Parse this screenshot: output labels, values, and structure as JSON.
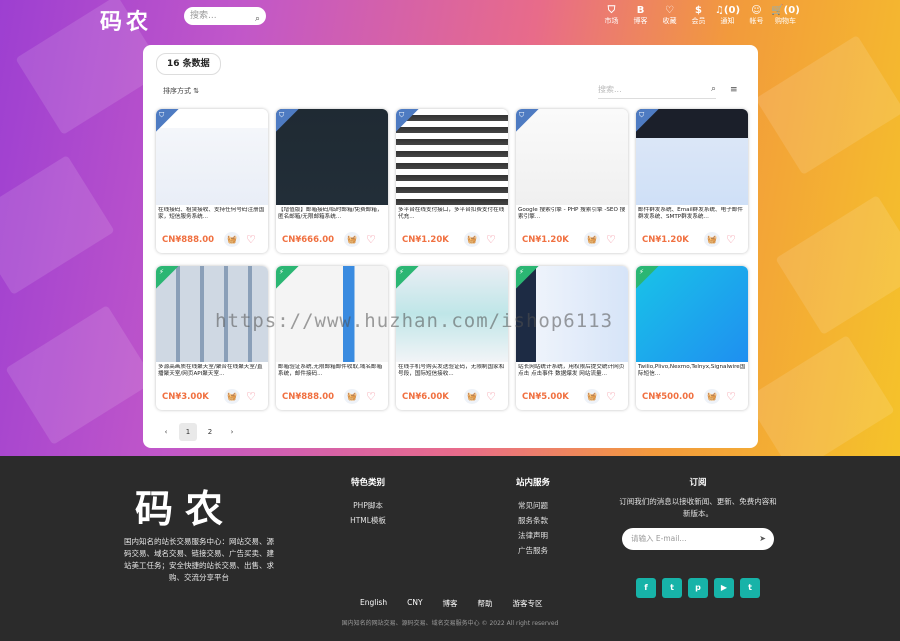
{
  "header": {
    "logo": "码农",
    "search_placeholder": "搜索...",
    "nav": [
      {
        "icon": "tag-icon",
        "glyph": "⛉",
        "label": "市场"
      },
      {
        "icon": "bitcoin-icon",
        "glyph": "B",
        "label": "博客"
      },
      {
        "icon": "heart-icon",
        "glyph": "♡",
        "label": "收藏"
      },
      {
        "icon": "dollar-icon",
        "glyph": "$",
        "label": "会员"
      },
      {
        "icon": "bell-icon",
        "glyph": "♫(0)",
        "label": "通知"
      },
      {
        "icon": "user-icon",
        "glyph": "☺",
        "label": "帐号"
      },
      {
        "icon": "cart-icon",
        "glyph": "🛒(0)",
        "label": "购物车"
      }
    ]
  },
  "listing": {
    "count_label": "16 条数据",
    "sort_label": "排序方式",
    "search_placeholder": "搜索...",
    "products": [
      {
        "desc": "在线接码、租赁接收、支持任何号码注册国家，短信服务系统...",
        "price": "CN¥888.00",
        "ribbon": "blue",
        "thumb": "light"
      },
      {
        "desc": "【增值版】邮箱接码/临时邮箱/免费邮箱，匿名邮箱/无限邮箱系统...",
        "price": "CN¥666.00",
        "ribbon": "blue",
        "thumb": "dark"
      },
      {
        "desc": "多平台在线支付接口，多平台扣费支付在线代充...",
        "price": "CN¥1.20K",
        "ribbon": "blue",
        "thumb": "code"
      },
      {
        "desc": "Google 搜索引擎 - PHP 搜索引擎 -SEO 搜索引擎...",
        "price": "CN¥1.20K",
        "ribbon": "blue",
        "thumb": "google"
      },
      {
        "desc": "邮件群发系统、Email群发系统、电子邮件群发系统、SMTP群发系统...",
        "price": "CN¥1.20K",
        "ribbon": "blue",
        "thumb": "mail"
      },
      {
        "desc": "多源高画质在线聚天室/聚合在线聚天室/直播聚天室/网页API聚天室...",
        "price": "CN¥3.00K",
        "ribbon": "green",
        "thumb": "grid"
      },
      {
        "desc": "邮箱验证系统,无限邮箱邮件收取,域名邮箱系统，邮件接码...",
        "price": "CN¥888.00",
        "ribbon": "green",
        "thumb": "phone"
      },
      {
        "desc": "在线手机号购买发送验证码，无限制国家和号段，国际短信接收...",
        "price": "CN¥6.00K",
        "ribbon": "green",
        "thumb": "dash"
      },
      {
        "desc": "站长网站统计系统，用权限后提交统计网页点击 点击事件 数据爆发 网站流量...",
        "price": "CN¥5.00K",
        "ribbon": "green",
        "thumb": "stats"
      },
      {
        "desc": "Twilio,Plivo,Nexmo,Telnyx,Signalwire国际短信...",
        "price": "CN¥500.00",
        "ribbon": "green",
        "thumb": "cyan"
      }
    ],
    "pager": {
      "prev": "‹",
      "pages": [
        "1",
        "2"
      ],
      "next": "›"
    }
  },
  "footer": {
    "logo": "码农",
    "about": "国内知名的站长交易服务中心：网站交易、源码交易、域名交易、链接交易、广告买卖、建站美工任务；安全快捷的站长交易、出售、求购、交流分享平台",
    "col1": {
      "title": "特色类别",
      "items": [
        "PHP脚本",
        "HTML模板"
      ]
    },
    "col2": {
      "title": "站内服务",
      "items": [
        "常见问题",
        "服务条款",
        "法律声明",
        "广告服务"
      ]
    },
    "subscribe": {
      "title": "订阅",
      "text": "订阅我们的消息以接收新闻、更新、免费内容和新版本。",
      "placeholder": "请输入 E-mail...",
      "socials": [
        "f",
        "t",
        "p",
        "▶",
        "t"
      ]
    },
    "links": [
      "English",
      "CNY",
      "博客",
      "帮助",
      "游客专区"
    ],
    "copyright": "国内知名的网站交易、源码交易、域名交易服务中心 © 2022 All right reserved"
  },
  "watermark": "https://www.huzhan.com/ishop6113"
}
